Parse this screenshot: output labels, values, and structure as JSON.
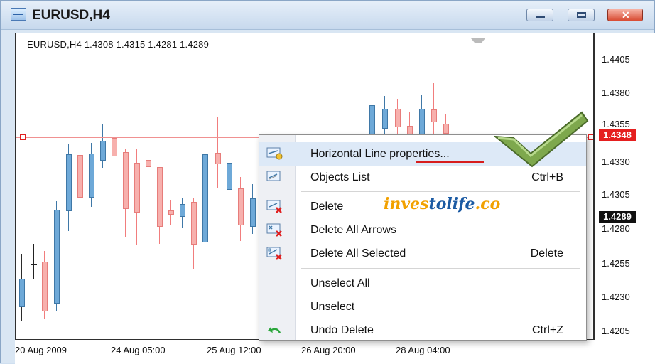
{
  "window": {
    "title": "EURUSD,H4",
    "buttons": {
      "minimize": "minimize",
      "maximize": "maximize",
      "close": "close"
    }
  },
  "chart": {
    "header_text": "EURUSD,H4  1.4308 1.4315 1.4281 1.4289",
    "price_labels": [
      "1.4405",
      "1.4380",
      "1.4355",
      "1.4330",
      "1.4305",
      "1.4280",
      "1.4255",
      "1.4230",
      "1.4205"
    ],
    "highlight_price": "1.4348",
    "current_price": "1.4289",
    "time_labels": [
      "20 Aug 2009",
      "24 Aug 05:00",
      "25 Aug 12:00",
      "26 Aug 20:00",
      "28 Aug 04:00"
    ],
    "colors": {
      "up_candle": "#6ea9d8",
      "down_candle": "#f7b0ad",
      "line": "#f09191",
      "price_tag_red": "#e51f1f",
      "price_tag_black": "#111111"
    }
  },
  "context_menu": {
    "items": [
      {
        "label": "Horizontal Line properties...",
        "shortcut": "",
        "icon": "line-properties-icon"
      },
      {
        "label": "Objects List",
        "shortcut": "Ctrl+B",
        "icon": "objects-list-icon"
      },
      {
        "label": "Delete",
        "shortcut": "",
        "icon": "delete-icon"
      },
      {
        "label": "Delete All Arrows",
        "shortcut": "",
        "icon": "delete-arrows-icon"
      },
      {
        "label": "Delete All Selected",
        "shortcut": "Delete",
        "icon": "delete-selected-icon"
      },
      {
        "label": "Unselect All",
        "shortcut": "",
        "icon": ""
      },
      {
        "label": "Unselect",
        "shortcut": "",
        "icon": ""
      },
      {
        "label": "Undo Delete",
        "shortcut": "Ctrl+Z",
        "icon": "undo-icon"
      }
    ]
  },
  "watermark": {
    "part1": "inves",
    "part2": "tolife",
    "part3": ".co"
  }
}
